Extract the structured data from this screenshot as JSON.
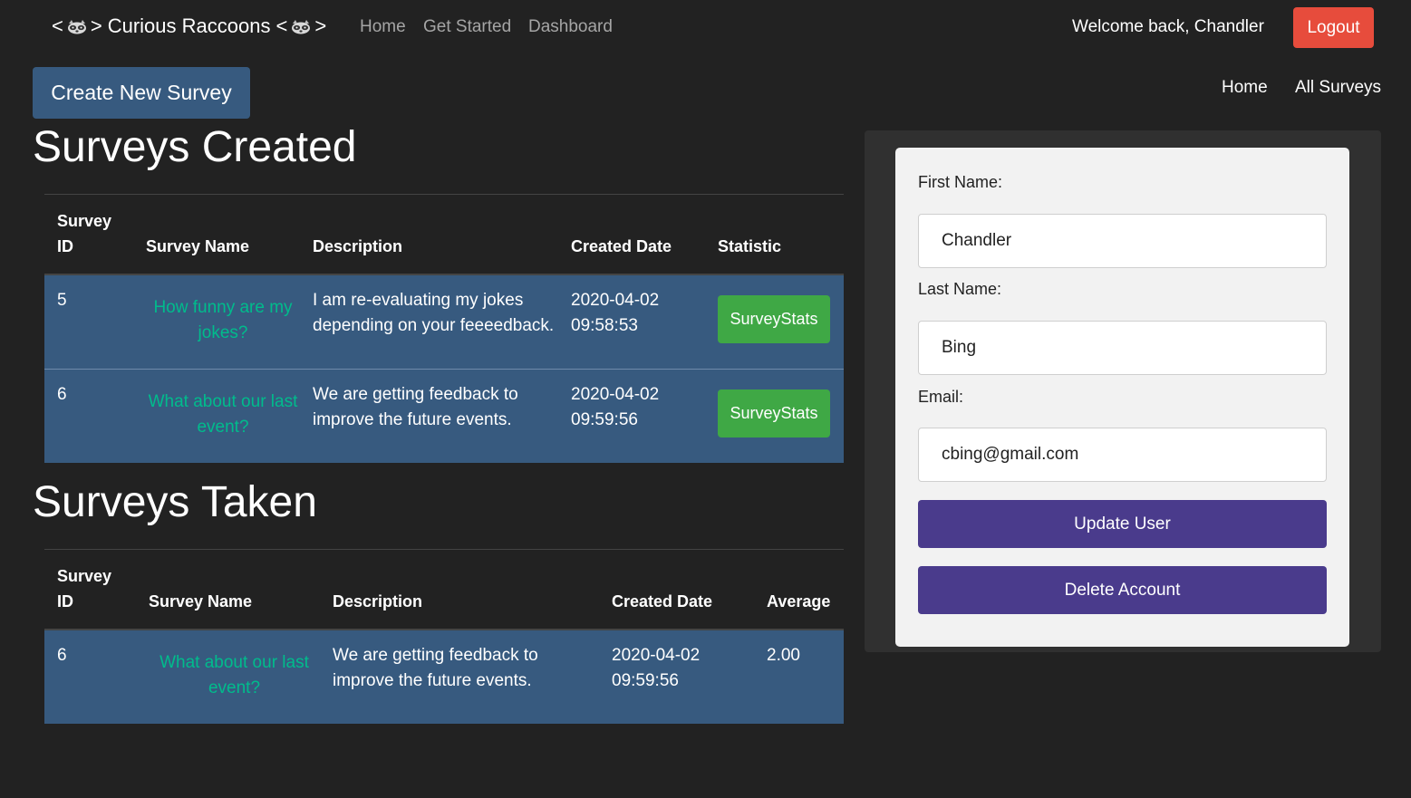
{
  "navbar": {
    "brand_prefix": "<",
    "brand_separator": ">",
    "brand_name": "Curious Raccoons",
    "brand_suffix_open": "<",
    "brand_suffix_close": ">",
    "links": [
      "Home",
      "Get Started",
      "Dashboard"
    ],
    "welcome": "Welcome back, Chandler",
    "logout": "Logout",
    "icon": "raccoon-icon"
  },
  "actions": {
    "create_survey": "Create New Survey"
  },
  "sub_nav": {
    "links": [
      "Home",
      "All Surveys"
    ]
  },
  "surveys_created": {
    "title": "Surveys Created",
    "headers": {
      "id_line1": "Survey",
      "id_line2": "ID",
      "name": "Survey Name",
      "description": "Description",
      "created": "Created Date",
      "statistic": "Statistic"
    },
    "rows": [
      {
        "id": "5",
        "name": "How funny are my jokes?",
        "description": "I am re-evaluating my jokes depending on your feeeedback.",
        "created_date": "2020-04-02",
        "created_time": "09:58:53",
        "stat_label": "SurveyStats"
      },
      {
        "id": "6",
        "name": "What about our last event?",
        "description": "We are getting feedback to improve the future events.",
        "created_date": "2020-04-02",
        "created_time": "09:59:56",
        "stat_label": "SurveyStats"
      }
    ]
  },
  "surveys_taken": {
    "title": "Surveys Taken",
    "headers": {
      "id_line1": "Survey",
      "id_line2": "ID",
      "name": "Survey Name",
      "description": "Description",
      "created": "Created Date",
      "average": "Average"
    },
    "rows": [
      {
        "id": "6",
        "name": "What about our last event?",
        "description": "We are getting feedback to improve the future events.",
        "created_date": "2020-04-02",
        "created_time": "09:59:56",
        "average": "2.00"
      }
    ]
  },
  "user_form": {
    "first_name_label": "First Name:",
    "first_name_value": "Chandler",
    "last_name_label": "Last Name:",
    "last_name_value": "Bing",
    "email_label": "Email:",
    "email_value": "cbing@gmail.com",
    "update_label": "Update User",
    "delete_label": "Delete Account"
  },
  "colors": {
    "background": "#222222",
    "primary": "#375a7f",
    "success": "#3fa845",
    "danger": "#e74c3c",
    "link": "#00bc8c",
    "purple": "#4a3b8c"
  }
}
